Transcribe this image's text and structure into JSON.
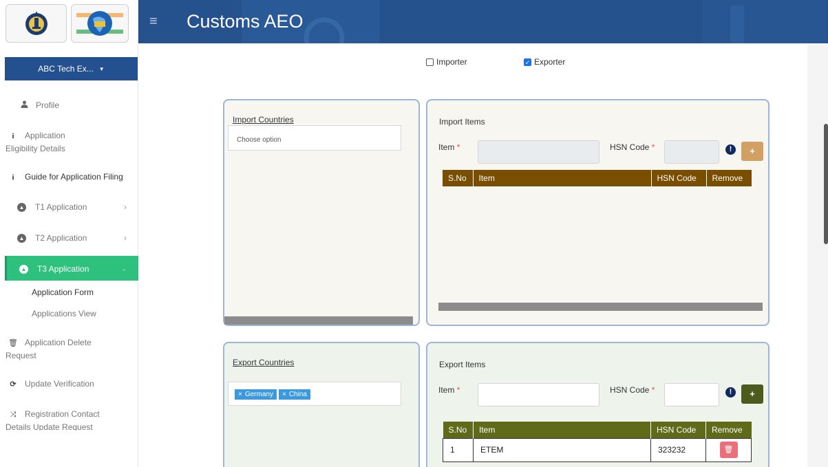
{
  "header": {
    "title": "Customs AEO",
    "menu_icon": "hamburger-icon",
    "brand_color": "#25518d"
  },
  "user": {
    "name": "ABC Tech Ex..."
  },
  "sidebar": {
    "items": [
      {
        "label": "Profile",
        "icon": "user-icon"
      },
      {
        "label": "Application Eligibility Details",
        "line1": "Application",
        "line2": "Eligibility Details",
        "icon": "info-icon"
      },
      {
        "label": "Guide for Application Filing",
        "icon": "info-icon"
      },
      {
        "label": "T1 Application",
        "icon": "circle-a-icon"
      },
      {
        "label": "T2 Application",
        "icon": "circle-a-icon"
      },
      {
        "label": "T3 Application",
        "icon": "circle-a-icon",
        "active": true
      },
      {
        "label": "Application Delete Request",
        "line1": "Application Delete",
        "line2": "Request",
        "icon": "trash-icon"
      },
      {
        "label": "Update Verification",
        "icon": "refresh-icon"
      },
      {
        "label": "Registration Contact Details Update Request",
        "line1": "Registration Contact",
        "line2": "Details Update Request",
        "icon": "shuffle-icon"
      }
    ],
    "t3_sub": [
      "Application Form",
      "Applications View"
    ],
    "active_color": "#2ec07d"
  },
  "roles": {
    "importer": {
      "label": "Importer",
      "checked": false
    },
    "exporter": {
      "label": "Exporter",
      "checked": true
    }
  },
  "import_countries": {
    "label": "Import Countries",
    "placeholder": "Choose option"
  },
  "import_items": {
    "title": "Import Items",
    "item_label": "Item",
    "hsn_label": "HSN Code",
    "required_mark": "*",
    "add_label": "+",
    "columns": [
      "S.No",
      "Item",
      "HSN Code",
      "Remove"
    ],
    "rows": []
  },
  "export_countries": {
    "label": "Export Countries",
    "selected": [
      "Germany",
      "China"
    ],
    "remove_mark": "×"
  },
  "export_items": {
    "title": "Export Items",
    "item_label": "Item",
    "hsn_label": "HSN Code",
    "required_mark": "*",
    "add_label": "+",
    "columns": [
      "S.No",
      "Item",
      "HSN Code",
      "Remove"
    ],
    "rows": [
      {
        "sno": "1",
        "item": "ETEM",
        "hsn": "323232"
      }
    ]
  }
}
